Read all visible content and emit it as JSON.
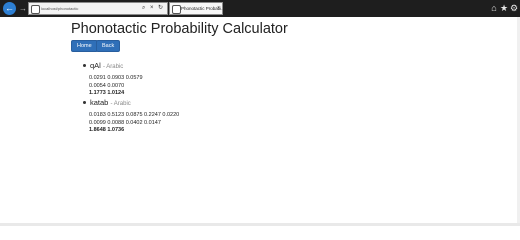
{
  "browser": {
    "url": "localhost/phonotactic",
    "tab_title": "Phonotactic Probabi...",
    "tab_close": "×",
    "icons": {
      "back": "←",
      "forward": "→",
      "search": "⌕",
      "refresh": "↻",
      "address_close": "×",
      "home": "⌂",
      "favorites": "★",
      "settings": "⚙"
    }
  },
  "page": {
    "title": "Phonotactic Probability Calculator",
    "buttons": {
      "home": "Home",
      "back": "Back"
    }
  },
  "results": [
    {
      "word": "qAl",
      "language": "- Arabic",
      "lines": [
        "0.0291 0.0903 0.0579",
        "0.0054 0.0070"
      ],
      "totals": "1.1773 1.0124"
    },
    {
      "word": "katab",
      "language": "- Arabic",
      "lines": [
        "0.0183 0.5123 0.0875 0.2247 0.0220",
        "0.0099 0.0088 0.0402 0.0147"
      ],
      "totals": "1.8648 1.0736"
    }
  ]
}
